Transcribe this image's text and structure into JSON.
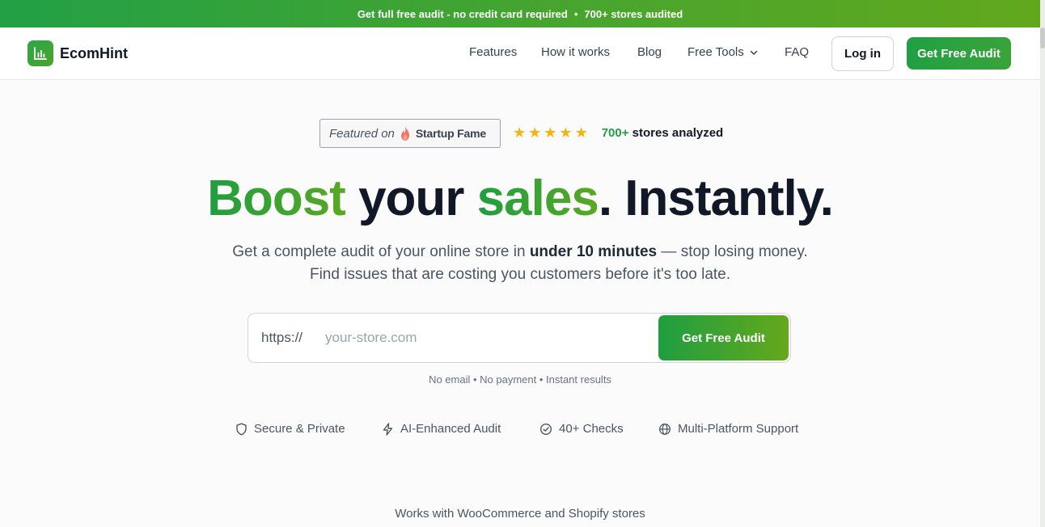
{
  "banner": {
    "text_a": "Get full free audit - no credit card required",
    "separator": "•",
    "text_b": "700+ stores audited"
  },
  "header": {
    "brand": "EcomHint",
    "logo_icon": "bar-chart-icon",
    "nav": [
      {
        "label": "Features"
      },
      {
        "label": "How it works"
      },
      {
        "label": "Blog"
      },
      {
        "label": "Free Tools",
        "icon": "chevron-down-icon"
      },
      {
        "label": "FAQ"
      }
    ],
    "login_label": "Log in",
    "cta_label": "Get Free Audit"
  },
  "hero": {
    "featured_prefix": "Featured on",
    "featured_brand": "Startup Fame",
    "featured_icon": "flame-icon",
    "stars": 5,
    "rating_count": "700+",
    "rating_label": "stores analyzed",
    "headline": {
      "w1": "Boost",
      "w2": "your",
      "w3": "sales",
      "w4": ". Instantly."
    },
    "sub": {
      "a": "Get a complete audit of your online store in",
      "bold": "under 10 minutes",
      "b": "— stop losing money.",
      "line2": "Find issues that are costing you customers before it's too late."
    },
    "form": {
      "prefix": "https://",
      "placeholder": "your-store.com",
      "value": "",
      "submit_label": "Get Free Audit"
    },
    "note": "No email • No payment • Instant results",
    "features": [
      {
        "label": "Secure & Private",
        "icon": "shield-icon"
      },
      {
        "label": "AI-Enhanced Audit",
        "icon": "lightning-icon"
      },
      {
        "label": "40+ Checks",
        "icon": "check-circle-icon"
      },
      {
        "label": "Multi-Platform Support",
        "icon": "globe-icon"
      }
    ],
    "works_with": "Works with WooCommerce and Shopify stores"
  },
  "colors": {
    "brand_green": "#22a045",
    "accent_lime": "#62a81d",
    "star": "#f5b50a",
    "text_dark": "#111827"
  }
}
